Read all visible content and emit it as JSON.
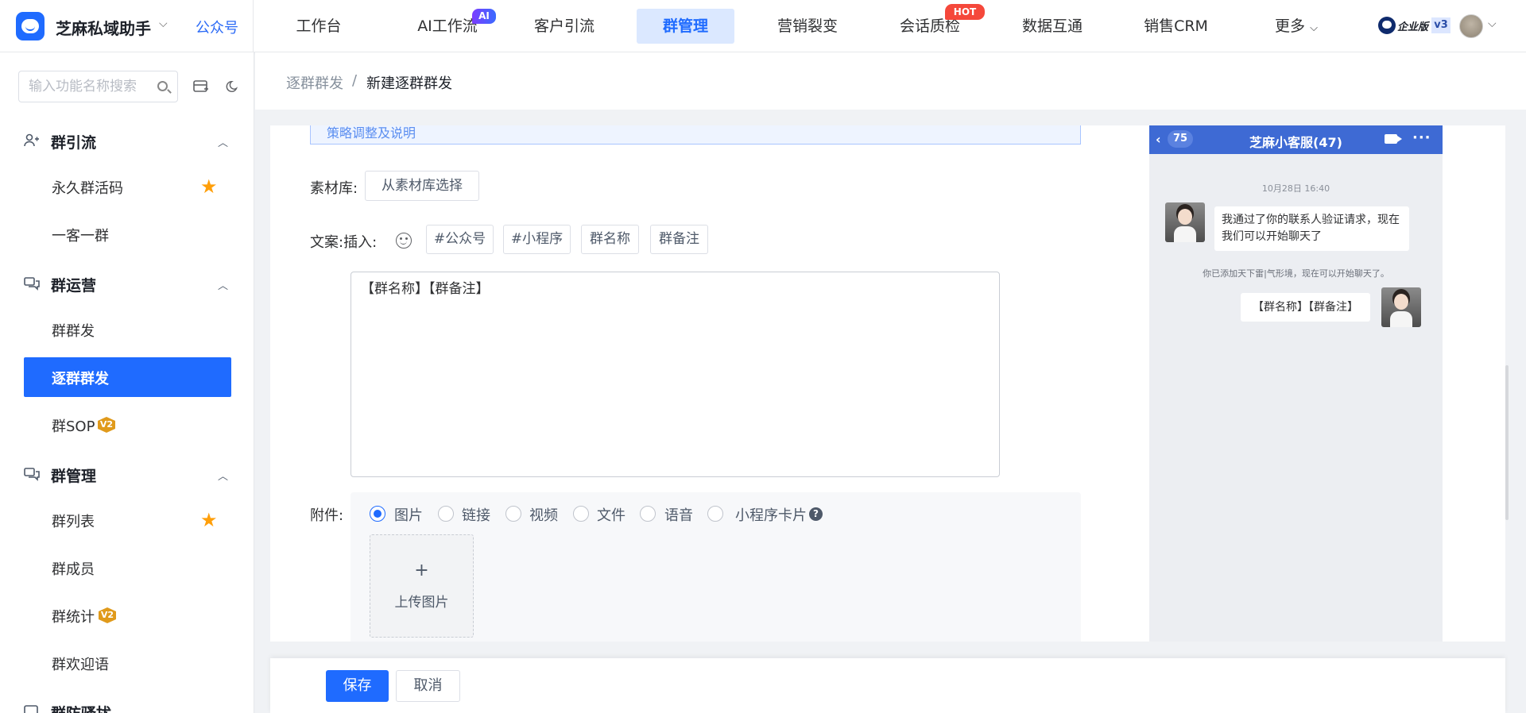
{
  "app": {
    "name": "芝麻私域助手",
    "account_type": "公众号",
    "edition_label": "企业版",
    "version_badge": "v3"
  },
  "nav": {
    "items": [
      "工作台",
      "AI工作流",
      "客户引流",
      "群管理",
      "营销裂变",
      "会话质检",
      "数据互通",
      "销售CRM",
      "更多"
    ],
    "active": "群管理",
    "ai_badge": "AI",
    "hot_badge": "HOT"
  },
  "sidebar": {
    "search_placeholder": "输入功能名称搜索",
    "groups": [
      {
        "title": "群引流",
        "items": [
          {
            "label": "永久群活码",
            "starred": true
          },
          {
            "label": "一客一群"
          }
        ]
      },
      {
        "title": "群运营",
        "items": [
          {
            "label": "群群发"
          },
          {
            "label": "逐群群发",
            "active": true
          },
          {
            "label": "群SOP",
            "badge": "V2"
          }
        ]
      },
      {
        "title": "群管理",
        "items": [
          {
            "label": "群列表",
            "starred": true
          },
          {
            "label": "群成员"
          },
          {
            "label": "群统计",
            "badge": "V2"
          },
          {
            "label": "群欢迎语"
          }
        ]
      },
      {
        "title": "群防骚扰",
        "items": []
      }
    ]
  },
  "breadcrumb": {
    "parent": "逐群群发",
    "separator": "/",
    "current": "新建逐群群发"
  },
  "form": {
    "tip_text": "策略调整及说明",
    "material_label": "素材库:",
    "material_button": "从素材库选择",
    "copy_label": "文案:",
    "insert_label": "插入:",
    "insert_tags": [
      "#公众号",
      "#小程序",
      "群名称",
      "群备注"
    ],
    "copy_text": "【群名称】【群备注】",
    "attachment_label": "附件:",
    "attachment_types": [
      "图片",
      "链接",
      "视频",
      "文件",
      "语音",
      "小程序卡片"
    ],
    "attachment_selected": "图片",
    "help_icon": "?",
    "upload_plus": "+",
    "upload_label": "上传图片"
  },
  "preview": {
    "back_count": "75",
    "title": "芝麻小客服(47)",
    "timestamp": "10月28日 16:40",
    "incoming_message": "我通过了你的联系人验证请求，现在我们可以开始聊天了",
    "system_note": "你已添加天下雷|气形境，现在可以开始聊天了。",
    "outgoing_message": "【群名称】【群备注】"
  },
  "footer": {
    "save": "保存",
    "cancel": "取消"
  },
  "colors": {
    "primary": "#1f6bff",
    "star": "#ff9f0a",
    "hot": "#f5483b",
    "phone_header": "#3e6ad4"
  }
}
